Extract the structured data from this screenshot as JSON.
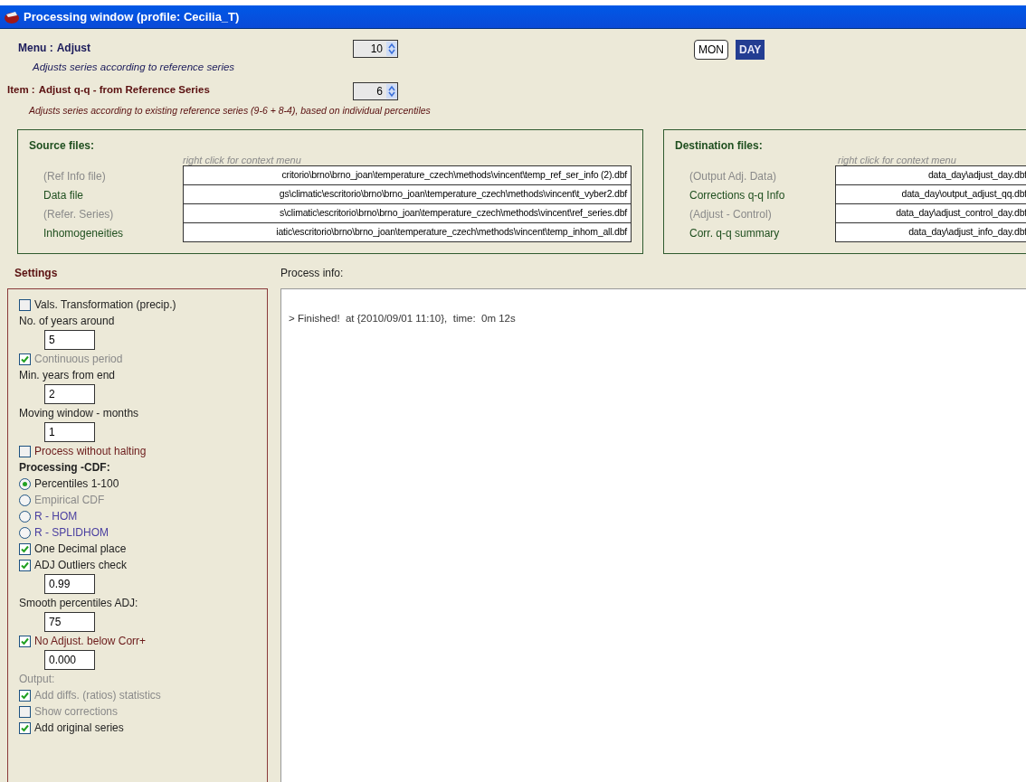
{
  "window": {
    "title": "Processing window (profile: Cecilia_T)"
  },
  "menu": {
    "label": "Menu :",
    "value": "Adjust",
    "description": "Adjusts series according to reference series",
    "spinner": "10"
  },
  "item": {
    "label": "Item :",
    "value": "Adjust q-q - from Reference Series",
    "description": "Adjusts series according to existing reference series (9-6 + 8-4), based on individual percentiles",
    "spinner": "6"
  },
  "period_toggle": [
    {
      "label": "MON",
      "selected": false
    },
    {
      "label": "DAY",
      "selected": true
    }
  ],
  "source_files": {
    "title": "Source files:",
    "hint": "right click for context menu",
    "rows": [
      {
        "label": "(Ref Info file)",
        "disabled": true,
        "value": "critorio\\brno\\brno_joan\\temperature_czech\\methods\\vincent\\temp_ref_ser_info (2).dbf"
      },
      {
        "label": "Data file",
        "disabled": false,
        "value": "gs\\climatic\\escritorio\\brno\\brno_joan\\temperature_czech\\methods\\vincent\\t_vyber2.dbf"
      },
      {
        "label": "(Refer. Series)",
        "disabled": true,
        "value": "s\\climatic\\escritorio\\brno\\brno_joan\\temperature_czech\\methods\\vincent\\ref_series.dbf"
      },
      {
        "label": "Inhomogeneities",
        "disabled": false,
        "value": "iatic\\escritorio\\brno\\brno_joan\\temperature_czech\\methods\\vincent\\temp_inhom_all.dbf"
      }
    ]
  },
  "destination_files": {
    "title": "Destination files:",
    "hint": "right click for context menu",
    "rows": [
      {
        "label": "(Output Adj. Data)",
        "disabled": true,
        "value": "data_day\\adjust_day.dbf"
      },
      {
        "label": "Corrections q-q Info",
        "disabled": false,
        "value": "data_day\\output_adjust_qq.dbf"
      },
      {
        "label": "(Adjust - Control)",
        "disabled": true,
        "value": "data_day\\adjust_control_day.dbf"
      },
      {
        "label": "Corr. q-q summary",
        "disabled": false,
        "value": "data_day\\adjust_info_day.dbf"
      }
    ]
  },
  "settings": {
    "title": "Settings",
    "items": [
      {
        "kind": "checkbox",
        "label": "Vals. Transformation (precip.)",
        "checked": false,
        "color": "#222222"
      },
      {
        "kind": "label",
        "label": "No. of years around",
        "color": "#222222"
      },
      {
        "kind": "field",
        "value": "5"
      },
      {
        "kind": "checkbox",
        "label": "Continuous period",
        "checked": true,
        "color": "#8a8a8a"
      },
      {
        "kind": "label",
        "label": "Min. years from end",
        "color": "#222222"
      },
      {
        "kind": "field",
        "value": "2"
      },
      {
        "kind": "label",
        "label": "Moving window - months",
        "color": "#222222"
      },
      {
        "kind": "field",
        "value": "1"
      },
      {
        "kind": "checkbox",
        "label": "Process without halting",
        "checked": false,
        "color": "#6b1a1a"
      },
      {
        "kind": "heading",
        "label": "Processing -CDF:",
        "color": "#222222"
      },
      {
        "kind": "radio",
        "label": "Percentiles 1-100",
        "selected": true,
        "color": "#222222"
      },
      {
        "kind": "radio",
        "label": "Empirical CDF",
        "selected": false,
        "color": "#8a8a8a"
      },
      {
        "kind": "radio",
        "label": "R - HOM",
        "selected": false,
        "color": "#4a3fa0"
      },
      {
        "kind": "radio",
        "label": "R - SPLIDHOM",
        "selected": false,
        "color": "#4a3fa0"
      },
      {
        "kind": "checkbox",
        "label": "One Decimal place",
        "checked": true,
        "color": "#222222"
      },
      {
        "kind": "checkbox",
        "label": "ADJ Outliers check",
        "checked": true,
        "color": "#222222"
      },
      {
        "kind": "field",
        "value": "0.99"
      },
      {
        "kind": "label",
        "label": "Smooth percentiles ADJ:",
        "color": "#222222"
      },
      {
        "kind": "field",
        "value": "75"
      },
      {
        "kind": "checkbox",
        "label": "No Adjust. below Corr+",
        "checked": true,
        "color": "#6b1a1a"
      },
      {
        "kind": "field",
        "value": "0.000"
      },
      {
        "kind": "label",
        "label": "Output:",
        "color": "#8a8a8a"
      },
      {
        "kind": "checkbox",
        "label": "Add diffs. (ratios) statistics",
        "checked": true,
        "color": "#8a8a8a"
      },
      {
        "kind": "checkbox",
        "label": "Show corrections",
        "checked": false,
        "color": "#8a8a8a"
      },
      {
        "kind": "checkbox",
        "label": "Add original series",
        "checked": true,
        "color": "#222222"
      }
    ]
  },
  "process_info": {
    "title": "Process info:",
    "lines": [
      "> Finished!  at {2010/09/01 11:10},  time:  0m 12s"
    ]
  }
}
